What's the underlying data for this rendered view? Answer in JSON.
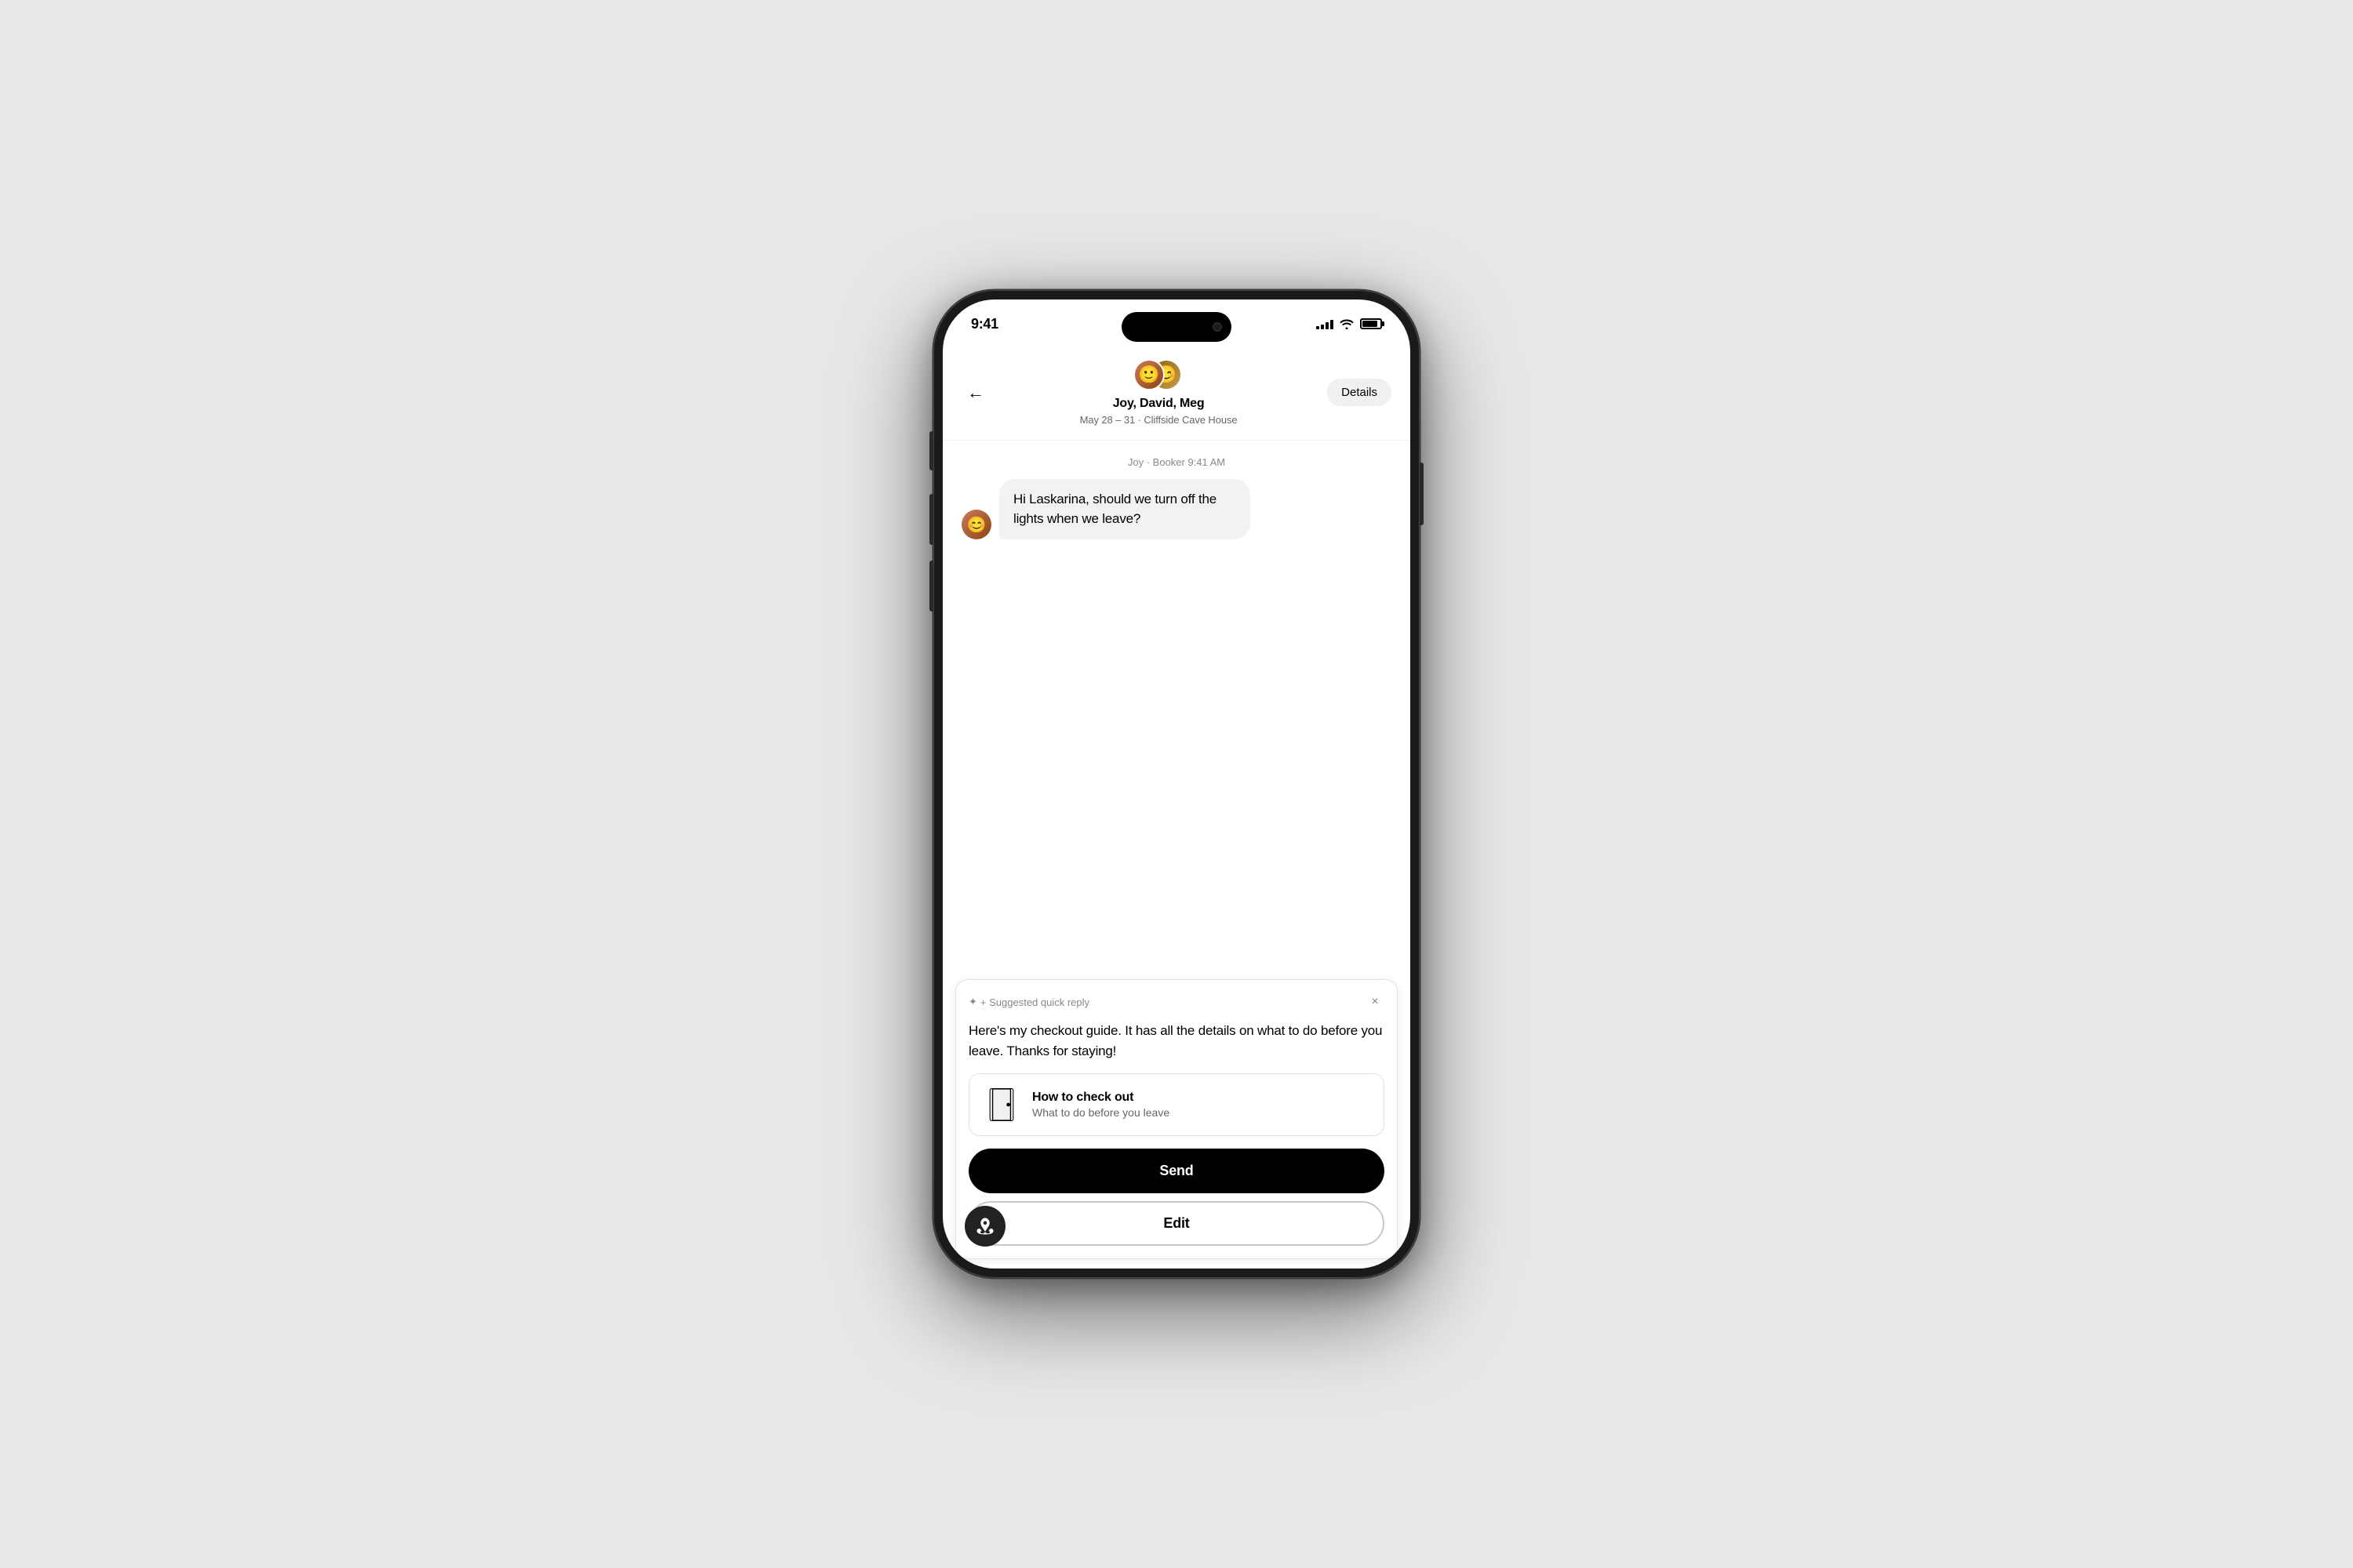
{
  "status_bar": {
    "time": "9:41",
    "signal_bars": [
      4,
      6,
      8,
      10,
      12
    ],
    "wifi": "wifi",
    "battery": "battery"
  },
  "header": {
    "back_label": "←",
    "participants": "Joy, David, Meg",
    "trip_info": "May 28 – 31 · Cliffside Cave House",
    "details_button": "Details"
  },
  "message": {
    "sender_info": "Joy · Booker  9:41 AM",
    "text": "Hi Laskarina, should we turn off the lights when we leave?"
  },
  "suggested_reply": {
    "label": "+ Suggested quick reply",
    "close": "×",
    "text": "Here's my checkout guide. It has all the details on what to do before you leave. Thanks for staying!",
    "checkout_card": {
      "title": "How to check out",
      "subtitle": "What to do before you leave"
    },
    "send_button": "Send",
    "edit_button": "Edit"
  }
}
